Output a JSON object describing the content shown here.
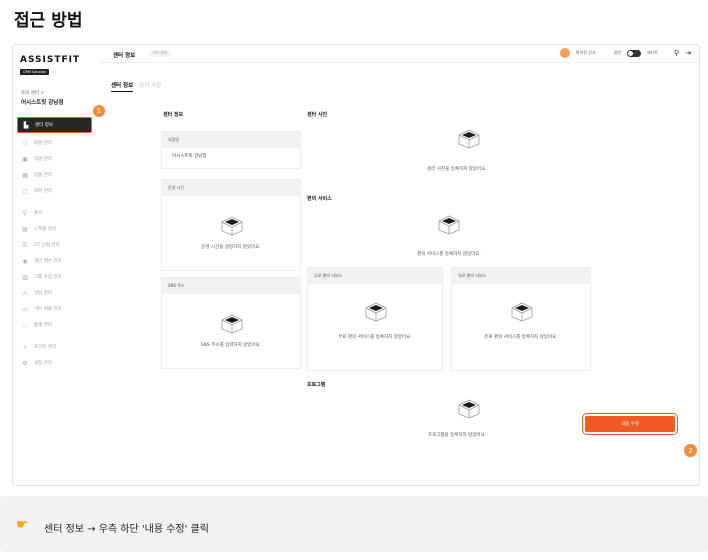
{
  "page_title": "접근 방법",
  "app": {
    "logo": "ASSISTFIT",
    "logo_badge": "CRM Solution",
    "crumb_top": "로의 센터 >",
    "crumb_name": "어시스트핏 강남점"
  },
  "sidebar": {
    "items": [
      {
        "label": "센터 정보",
        "icon": "building-icon",
        "active": true
      },
      {
        "label": "회원 관리",
        "icon": "users-icon",
        "active": false
      },
      {
        "label": "직원 관리",
        "icon": "staff-icon",
        "active": false
      },
      {
        "label": "상품 관리",
        "icon": "grid-icon",
        "active": false
      },
      {
        "label": "락커 관리",
        "icon": "locker-icon",
        "active": false
      },
      {
        "label": "출석",
        "icon": "attendance-icon",
        "active": false
      },
      {
        "label": "스케줄 관리",
        "icon": "calendar-icon",
        "active": false
      },
      {
        "label": "OT 신청 관리",
        "icon": "list-icon",
        "active": false
      },
      {
        "label": "개인 레슨 관리",
        "icon": "eye-icon",
        "active": false
      },
      {
        "label": "그룹 수업 관리",
        "icon": "chart-icon",
        "active": false
      },
      {
        "label": "상담 관리",
        "icon": "headset-icon",
        "active": false
      },
      {
        "label": "기타 매출 관리",
        "icon": "card-icon",
        "active": false
      },
      {
        "label": "통계 관리",
        "icon": "stats-icon",
        "active": false
      },
      {
        "label": "포인트 관리",
        "icon": "sparkle-icon",
        "active": false
      },
      {
        "label": "설정 관리",
        "icon": "settings-icon",
        "active": false
      }
    ]
  },
  "header": {
    "title": "센터 정보",
    "chip": "센터 정보",
    "user": "박어핏 강사",
    "toggle_label": "일반",
    "toggle_label_right": "에디트"
  },
  "tabs": [
    {
      "label": "센터 정보",
      "active": true
    },
    {
      "label": "공지 사항",
      "active": false
    }
  ],
  "center_info": {
    "section_label": "센터 정보",
    "center_name_head": "지점명",
    "center_name": "어시스트핏 강남점",
    "hours_head": "운영 시간",
    "hours_empty": "운영 시간을 설정하지 않았어요.",
    "sns_head": "SNS 주소",
    "sns_empty": "SNS 주소를 입력하지 않았어요."
  },
  "center_photo": {
    "section_label": "센터 사진",
    "empty": "센터 사진을 등록하지 않았어요."
  },
  "facilities": {
    "section_label": "편의 서비스",
    "empty": "편의 서비스를 등록하지 않았어요.",
    "free_head": "무료 편의 서비스",
    "free_empty": "무료 편의 서비스를 등록하지 않았어요.",
    "paid_head": "유료 편의 서비스",
    "paid_empty": "유료 편의 서비스를 등록하지 않았어요."
  },
  "programs": {
    "section_label": "프로그램",
    "empty": "프로그램을 등록하지 않았어요."
  },
  "edit_button": "내용 수정",
  "steps": {
    "one": "1",
    "two": "2"
  },
  "tip": {
    "icon": "pointing-hand-icon",
    "text": "센터 정보 → 우측 하단 '내용 수정' 클릭"
  },
  "colors": {
    "accent": "#f15a22",
    "step": "#f58a3d",
    "active_nav": "#262626"
  }
}
